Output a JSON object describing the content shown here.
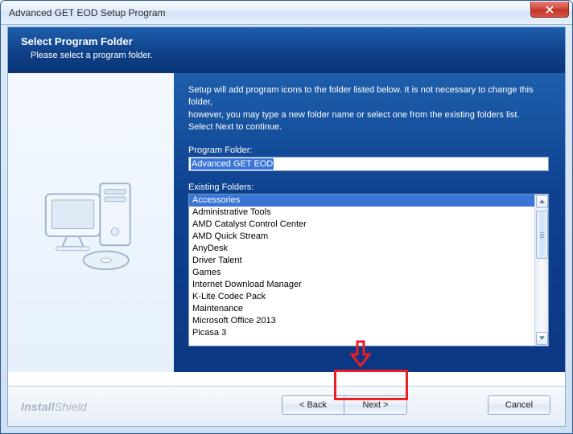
{
  "window": {
    "title": "Advanced GET EOD Setup Program"
  },
  "header": {
    "title": "Select Program Folder",
    "subtitle": "Please select a program folder."
  },
  "instructions": {
    "line1": "Setup will add program icons to the folder listed below.  It is not necessary to change this folder,",
    "line2": "however, you may type a new folder name or select one from the existing folders list.",
    "line3": "Select Next to continue."
  },
  "labels": {
    "program_folder": "Program Folder:",
    "existing_folders": "Existing Folders:"
  },
  "program_folder_value": "Advanced GET EOD",
  "folders": [
    "Accessories",
    "Administrative Tools",
    "AMD Catalyst Control Center",
    "AMD Quick Stream",
    "AnyDesk",
    "Driver Talent",
    "Games",
    "Internet Download Manager",
    "K-Lite Codec Pack",
    "Maintenance",
    "Microsoft Office 2013",
    "Picasa 3"
  ],
  "selected_folder_index": 0,
  "buttons": {
    "back": "< Back",
    "next": "Next >",
    "cancel": "Cancel"
  },
  "brand": {
    "a": "Install",
    "b": "Shield"
  }
}
